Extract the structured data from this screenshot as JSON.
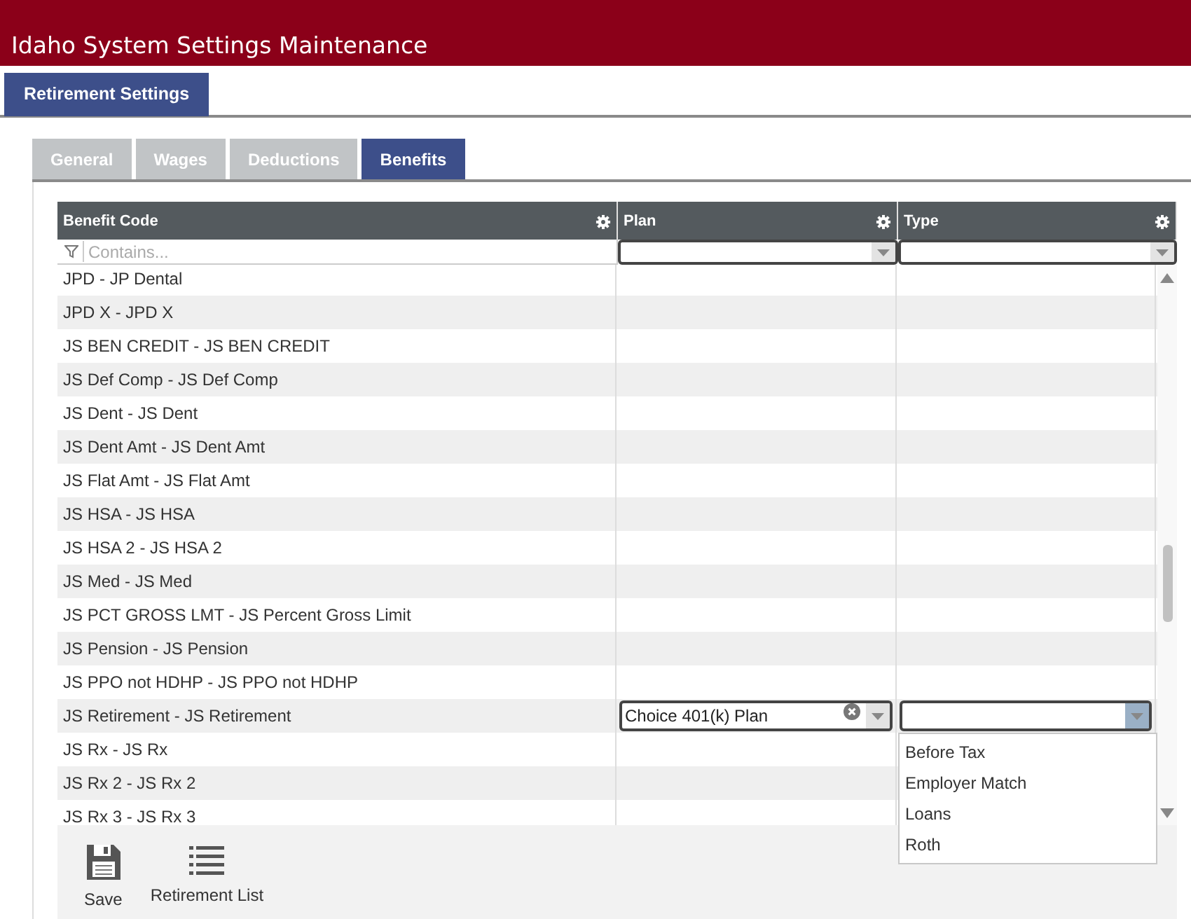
{
  "header": {
    "title": "Idaho System Settings Maintenance"
  },
  "main_tabs": [
    {
      "label": "Retirement Settings",
      "selected": true
    }
  ],
  "sub_tabs": [
    {
      "label": "General",
      "selected": false
    },
    {
      "label": "Wages",
      "selected": false
    },
    {
      "label": "Deductions",
      "selected": false
    },
    {
      "label": "Benefits",
      "selected": true
    }
  ],
  "grid": {
    "columns": [
      {
        "label": "Benefit Code",
        "filter": {
          "kind": "text",
          "placeholder": "Contains..."
        }
      },
      {
        "label": "Plan",
        "filter": {
          "kind": "dropdown"
        }
      },
      {
        "label": "Type",
        "filter": {
          "kind": "dropdown"
        }
      }
    ],
    "rows": [
      {
        "benefit_code": "JPD - JP Dental"
      },
      {
        "benefit_code": "JPD X - JPD X"
      },
      {
        "benefit_code": "JS BEN CREDIT - JS BEN CREDIT"
      },
      {
        "benefit_code": "JS Def Comp - JS Def Comp"
      },
      {
        "benefit_code": "JS Dent - JS Dent"
      },
      {
        "benefit_code": "JS Dent Amt - JS Dent Amt"
      },
      {
        "benefit_code": "JS Flat Amt - JS Flat Amt"
      },
      {
        "benefit_code": "JS HSA - JS HSA"
      },
      {
        "benefit_code": "JS HSA 2 - JS HSA 2"
      },
      {
        "benefit_code": "JS Med - JS Med"
      },
      {
        "benefit_code": "JS PCT GROSS LMT - JS Percent Gross Limit"
      },
      {
        "benefit_code": "JS Pension - JS Pension"
      },
      {
        "benefit_code": "JS PPO not HDHP - JS PPO not HDHP"
      },
      {
        "benefit_code": "JS Retirement - JS Retirement",
        "editor": {
          "plan": "Choice 401(k) Plan",
          "type_expanded": true,
          "type_options": [
            "Before Tax",
            "Employer Match",
            "Loans",
            "Roth"
          ]
        }
      },
      {
        "benefit_code": "JS Rx - JS Rx"
      },
      {
        "benefit_code": "JS Rx 2 - JS Rx 2"
      },
      {
        "benefit_code": "JS Rx 3 - JS Rx 3"
      }
    ]
  },
  "toolbar": {
    "buttons": [
      {
        "kind": "save",
        "label": "Save"
      },
      {
        "kind": "list",
        "label": "Retirement List"
      }
    ]
  }
}
